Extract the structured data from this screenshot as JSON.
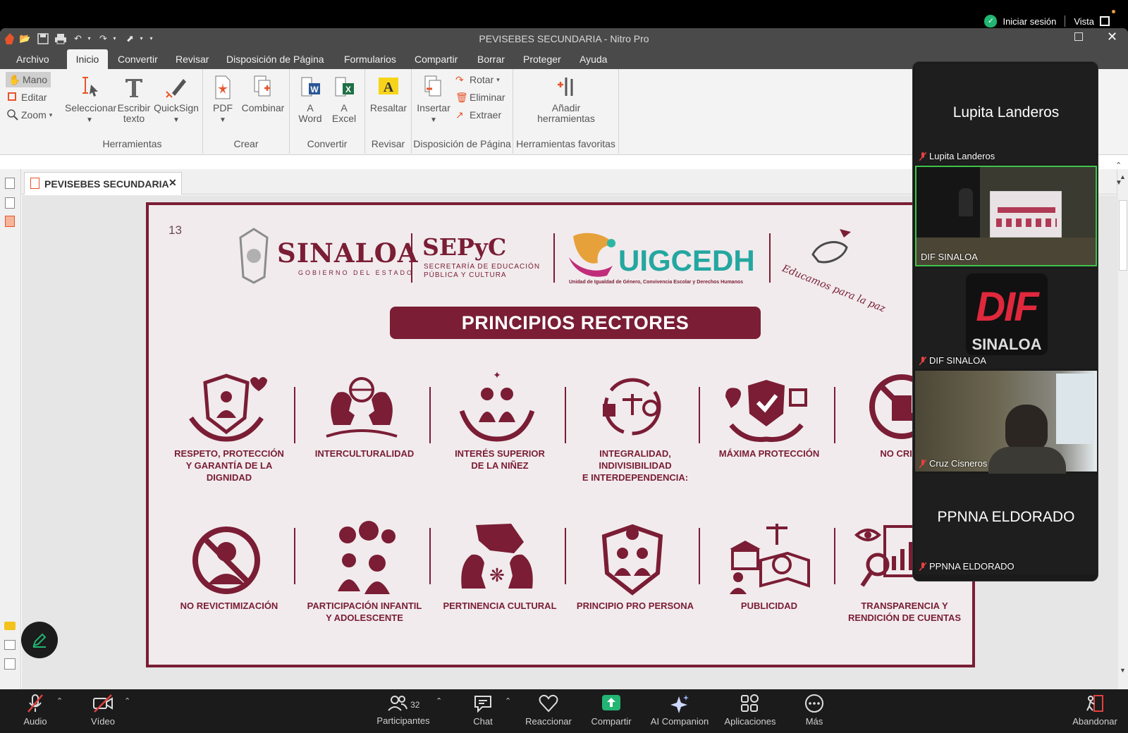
{
  "window": {
    "title": "PEVISEBES SECUNDARIA - Nitro Pro"
  },
  "zoom_top": {
    "signin": "Iniciar sesión",
    "view": "Vista"
  },
  "menu": [
    "Archivo",
    "Inicio",
    "Convertir",
    "Revisar",
    "Disposición de Página",
    "Formularios",
    "Compartir",
    "Borrar",
    "Proteger",
    "Ayuda"
  ],
  "ribbon": {
    "modes": [
      "Mano",
      "Editar",
      "Zoom"
    ],
    "herramientas": {
      "title": "Herramientas",
      "select": "Seleccionar",
      "write1": "Escribir",
      "write2": "texto",
      "quicksign": "QuickSign"
    },
    "crear": {
      "title": "Crear",
      "pdf": "PDF",
      "combine": "Combinar"
    },
    "convertir": {
      "title": "Convertir",
      "word1": "A",
      "word2": "Word",
      "excel1": "A",
      "excel2": "Excel"
    },
    "revisar": {
      "title": "Revisar",
      "highlight": "Resaltar"
    },
    "disposicion": {
      "title": "Disposición de Página",
      "insert": "Insertar",
      "rotate": "Rotar",
      "delete": "Eliminar",
      "extract": "Extraer"
    },
    "favoritas": {
      "title": "Herramientas favoritas",
      "add1": "Añadir",
      "add2": "herramientas"
    }
  },
  "doc_tab": "PEVISEBES SECUNDARIA",
  "slide": {
    "page_number": "13",
    "logo_sinaloa": "SINALOA",
    "logo_sinaloa_sub": "GOBIERNO DEL ESTADO",
    "logo_sepyc": "SEPyC",
    "logo_sepyc_sub1": "SECRETARÍA DE EDUCACIÓN",
    "logo_sepyc_sub2": "PÚBLICA Y CULTURA",
    "logo_uigcedh": "UIGCEDH",
    "logo_uigcedh_sub": "Unidad de Igualdad de Género, Convivencia Escolar y Derechos Humanos",
    "logo_paz": "Educamos para la paz",
    "banner": "PRINCIPIOS RECTORES",
    "row1": [
      {
        "l1": "RESPETO, PROTECCIÓN",
        "l2": "Y GARANTÍA DE LA DIGNIDAD",
        "icon": "hands-shield-person-icon"
      },
      {
        "l1": "INTERCULTURALIDAD",
        "l2": "",
        "icon": "profiles-globe-icon"
      },
      {
        "l1": "INTERÉS SUPERIOR",
        "l2": "DE LA NIÑEZ",
        "icon": "hands-children-icon"
      },
      {
        "l1": "INTEGRALIDAD, INDIVISIBILIDAD",
        "l2": "E INTERDEPENDENCIA:",
        "icon": "cycle-scales-icon"
      },
      {
        "l1": "MÁXIMA PROTECCIÓN",
        "l2": "",
        "icon": "heart-shield-hands-icon"
      },
      {
        "l1": "NO CRIMIN",
        "l2": "",
        "icon": "prohibited-person-icon"
      }
    ],
    "row2": [
      {
        "l1": "NO REVICTIMIZACIÓN",
        "l2": "",
        "icon": "prohibited-crying-icon"
      },
      {
        "l1": "PARTICIPACIÓN INFANTIL",
        "l2": "Y ADOLESCENTE",
        "icon": "speech-children-icon"
      },
      {
        "l1": "PERTINENCIA CULTURAL",
        "l2": "",
        "icon": "map-profiles-icon"
      },
      {
        "l1": "PRINCIPIO PRO PERSONA",
        "l2": "",
        "icon": "shield-family-icon"
      },
      {
        "l1": "PUBLICIDAD",
        "l2": "",
        "icon": "building-people-book-icon"
      },
      {
        "l1": "TRANSPARENCIA Y",
        "l2": "RENDICIÓN DE CUENTAS",
        "icon": "eye-magnifier-report-icon"
      }
    ]
  },
  "participants": [
    {
      "big": "Lupita Landeros",
      "name": "Lupita Landeros",
      "type": "name"
    },
    {
      "big": "",
      "name": "DIF SINALOA",
      "type": "video-room"
    },
    {
      "big": "DIF SINALOA",
      "name": "DIF SINALOA",
      "type": "logo"
    },
    {
      "big": "",
      "name": "Cruz Cisneros",
      "type": "video-person"
    },
    {
      "big": "PPNNA ELDORADO",
      "name": "PPNNA ELDORADO",
      "type": "name"
    }
  ],
  "zoom_bar": {
    "audio": "Audio",
    "video": "Vídeo",
    "participants": "Participantes",
    "participants_count": "32",
    "chat": "Chat",
    "react": "Reaccionar",
    "share": "Compartir",
    "ai": "AI Companion",
    "apps": "Aplicaciones",
    "more": "Más",
    "leave": "Abandonar"
  },
  "colors": {
    "maroon": "#7a1d35",
    "slide_bg": "#f1ebed",
    "zoom_green": "#22b573"
  }
}
